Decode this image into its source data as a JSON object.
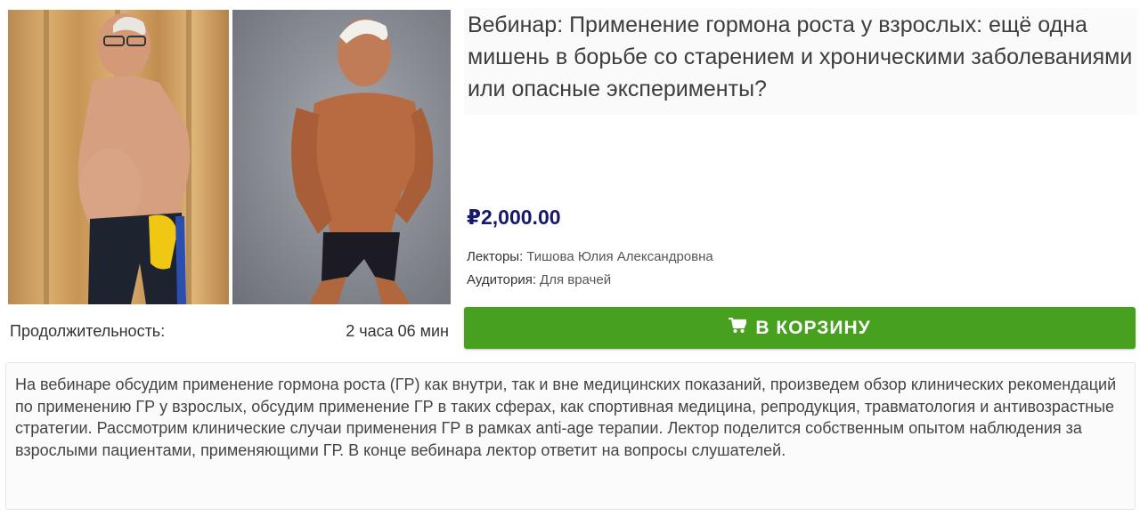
{
  "product": {
    "title": "Вебинар: Применение гормона роста у взрослых: ещё одна мишень в борьбе со старением и хроническими заболеваниями или опасные эксперименты?",
    "price": "₽2,000.00",
    "lecturers_label": "Лекторы:",
    "lecturers_value": "Тишова Юлия Александровна",
    "audience_label": "Аудитория:",
    "audience_value": "Для врачей",
    "duration_label": "Продолжительность:",
    "duration_value": "2 часа 06 мин",
    "cart_button_label": "В КОРЗИНУ",
    "cart_icon": "shopping-cart-icon",
    "description": "На вебинаре обсудим применение гормона роста (ГР) как внутри, так и вне медицинских показаний, произведем обзор клинических рекомендаций по применению ГР у взрослых, обсудим применение ГР в таких сферах, как спортивная медицина, репродукция, травматология и антивозрастные стратегии. Рассмотрим клинические случаи применения ГР в рамках anti-age терапии. Лектор поделится собственным опытом наблюдения за взрослыми пациентами, применяющими ГР. В конце вебинара лектор ответит на вопросы слушателей."
  },
  "images": {
    "before_photo": "before-after-photo-before",
    "after_photo": "before-after-photo-after"
  },
  "colors": {
    "price": "#16196b",
    "cart_button": "#48a01f",
    "title": "#3d3d3d"
  }
}
